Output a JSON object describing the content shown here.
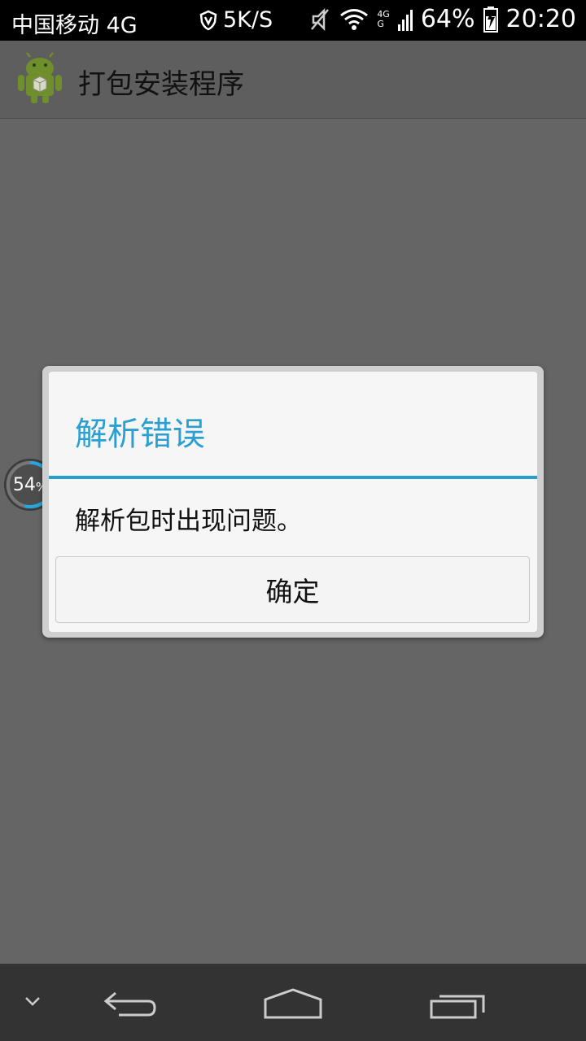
{
  "status_bar": {
    "carrier": "中国移动 4G",
    "speed": "5K/S",
    "net_badge_top": "4G",
    "net_badge_bottom": "G",
    "battery": "64%",
    "time": "20:20"
  },
  "action_bar": {
    "title": "打包安装程序",
    "icon": "android-package-icon"
  },
  "dialog": {
    "title": "解析错误",
    "message": "解析包时出现问题。",
    "ok_button": "确定"
  },
  "progress": {
    "value": "54",
    "unit": "%",
    "fraction": 0.54
  },
  "colors": {
    "accent": "#2a9dcf",
    "background": "#656565"
  }
}
